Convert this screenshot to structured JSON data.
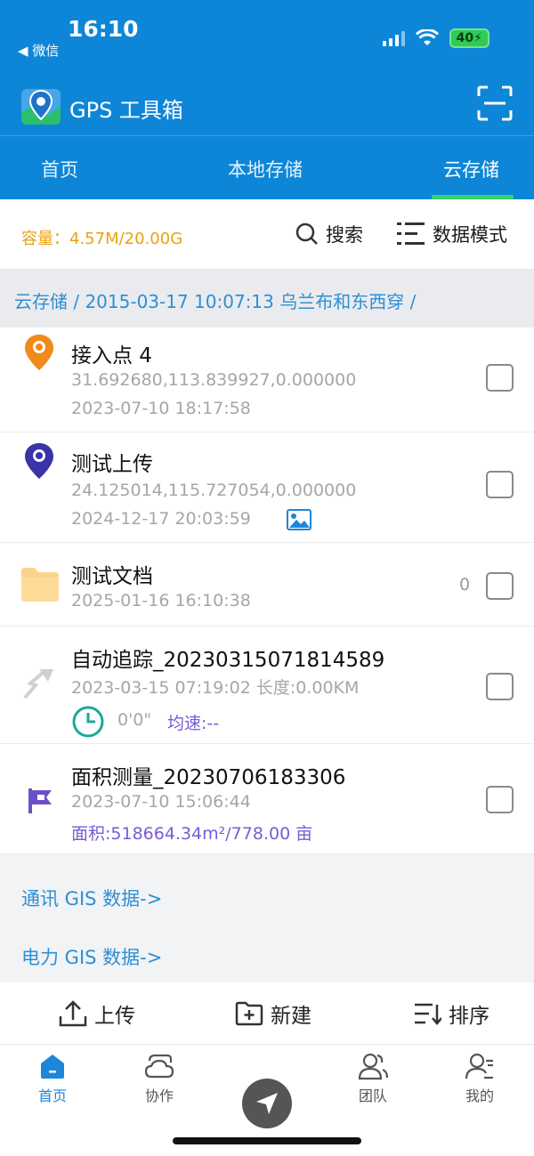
{
  "status": {
    "time": "16:10",
    "back_label": "◀ 微信",
    "battery": "40"
  },
  "header": {
    "title": "GPS 工具箱"
  },
  "tabs": [
    {
      "label": "首页"
    },
    {
      "label": "本地存储"
    },
    {
      "label": "云存储"
    }
  ],
  "toolbar": {
    "capacity": "容量：4.57M/20.00G",
    "search_label": "搜索",
    "mode_label": "数据模式"
  },
  "breadcrumb": "云存储 / 2015-03-17 10:07:13 乌兰布和东西穿 /",
  "items": [
    {
      "name": "接入点 4",
      "line1": "31.692680,113.839927,0.000000",
      "line2": "2023-07-10 18:17:58"
    },
    {
      "name": "测试上传",
      "line1": "24.125014,115.727054,0.000000",
      "line2": "2024-12-17 20:03:59"
    },
    {
      "name": "测试文档",
      "line1": "2025-01-16 16:10:38",
      "count": "0"
    },
    {
      "name": "自动追踪_20230315071814589",
      "line1": "2023-03-15 07:19:02 长度:0.00KM",
      "duration": "0'0\"",
      "speed": "均速:--"
    },
    {
      "name": "面积测量_20230706183306",
      "line1": "2023-07-10 15:06:44",
      "area": "面积:518664.34m²/778.00 亩"
    }
  ],
  "links": {
    "comm": "通讯 GIS 数据->",
    "power": "电力 GIS 数据->"
  },
  "actions": {
    "upload": "上传",
    "create": "新建",
    "sort": "排序"
  },
  "bottom_nav": [
    {
      "label": "首页"
    },
    {
      "label": "协作"
    },
    {
      "label": "团队"
    },
    {
      "label": "我的"
    }
  ],
  "colors": {
    "primary": "#0d86d8",
    "capacity": "#e9a20f",
    "link": "#2d8fd5",
    "accent_purple": "#7a5bd6"
  }
}
